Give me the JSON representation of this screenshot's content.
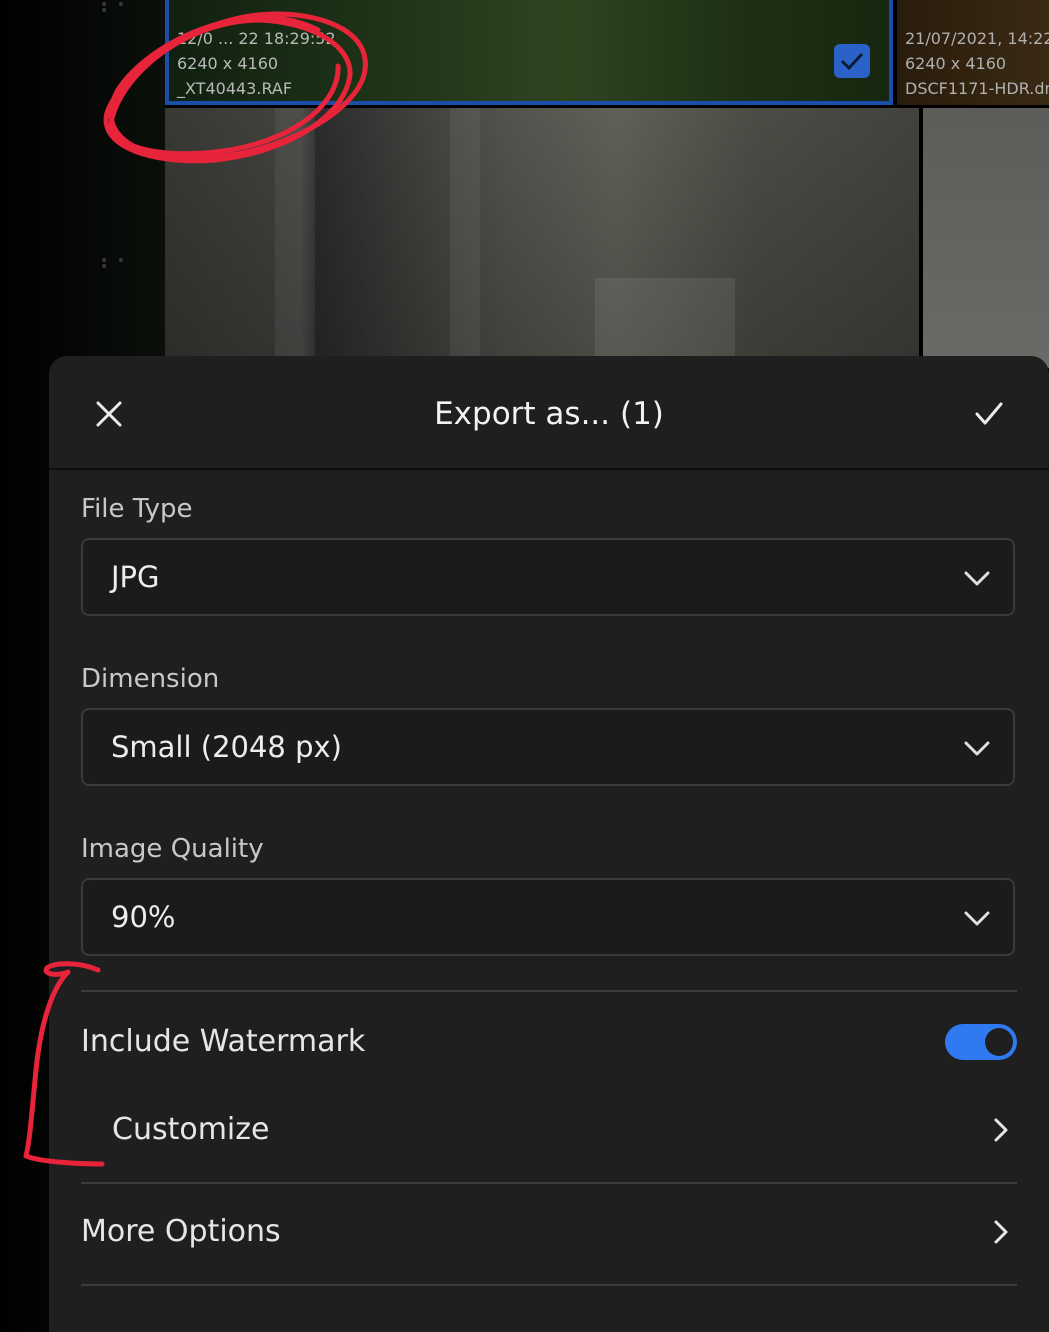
{
  "background": {
    "tile_top": {
      "datetime": "12/0 ... 22 18:29:52",
      "dimensions": "6240 x 4160",
      "filename": "_XT40443.RAF",
      "selected": true
    },
    "tile_right": {
      "datetime": "21/07/2021, 14:22:",
      "dimensions": "6240 x 4160",
      "filename": "DSCF1171-HDR.dn"
    }
  },
  "dialog": {
    "title": "Export as... (1)",
    "close_icon": "close-icon",
    "confirm_icon": "check-icon",
    "file_type": {
      "label": "File Type",
      "value": "JPG"
    },
    "dimension": {
      "label": "Dimension",
      "value": "Small (2048 px)"
    },
    "image_quality": {
      "label": "Image Quality",
      "value": "90%"
    },
    "watermark": {
      "label": "Include Watermark",
      "enabled": true
    },
    "customize": {
      "label": "Customize"
    },
    "more_options": {
      "label": "More Options"
    }
  },
  "colors": {
    "accent": "#2f7af0",
    "panel": "#1f1f1f",
    "annotation": "#e8243a"
  }
}
